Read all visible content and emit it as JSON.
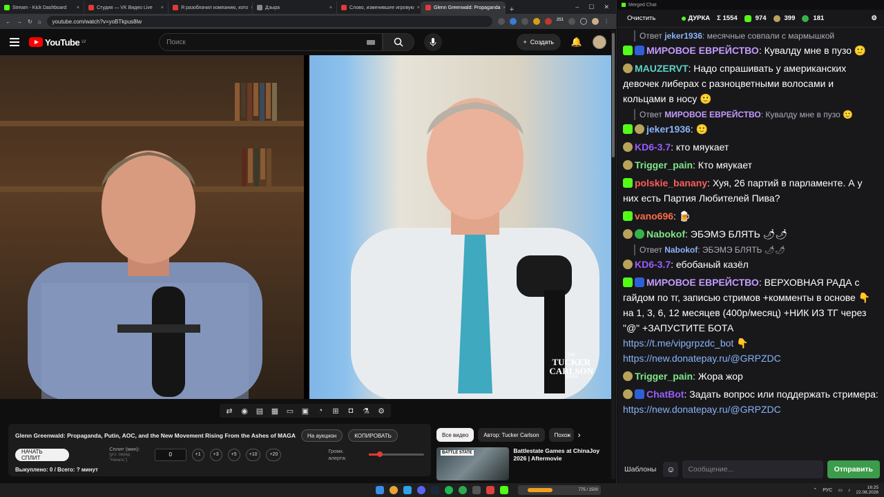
{
  "browser": {
    "tabs": [
      {
        "label": "Stream - Kick Dashboard",
        "color": "#53fc18"
      },
      {
        "label": "Студия — VK Видео Live",
        "color": "#e03a3a"
      },
      {
        "label": "Я разоблачил компанию, кото",
        "color": "#e03a3a"
      },
      {
        "label": "Дзыра",
        "color": "#888888"
      },
      {
        "label": "Слово, изменившее игровую",
        "color": "#e03a3a"
      },
      {
        "label": "Glenn Greenwald: Propaganda",
        "color": "#e03a3a"
      }
    ],
    "url": "youtube.com/watch?v=yoBTkpus8lw",
    "ext_badge": "251"
  },
  "youtube": {
    "logo_text": "YouTube",
    "region": "LV",
    "search_placeholder": "Поиск",
    "create_label": "Создать"
  },
  "video": {
    "watermark_the": "THE",
    "watermark_line1": "TUCKER",
    "watermark_line2": "CARLSON",
    "watermark_show": "SHOW"
  },
  "player_tools": [
    "loop-icon",
    "audio-icon",
    "subtitle-icon",
    "clip-icon",
    "frame-icon",
    "picture-icon",
    "speed-icon",
    "add-icon",
    "screenshot-icon",
    "flask-icon",
    "settings-icon"
  ],
  "info": {
    "title": "Glenn Greenwald: Propaganda, Putin, AOC, and the New Movement Rising From the Ashes of MAGA",
    "auction_label": "На аукцион",
    "copy_label": "КОПИРОВАТЬ",
    "split_button": "НАЧАТЬ СПЛИТ",
    "split_label": "Сплит (мин):",
    "split_hint": "(уст. перед \"Начать\")",
    "split_value": "0",
    "steps": [
      "+1",
      "+3",
      "+5",
      "+10",
      "+20"
    ],
    "volume_label": "Громк. алерта:",
    "volume_level": 0.2,
    "status": "Выкуплено: 0 / Всего: ? минут"
  },
  "related": {
    "chips": [
      "Все видео",
      "Автор: Tucker Carlson",
      "Похож"
    ],
    "item_title": "Battlestate Games at ChinaJoy 2026 | Aftermovie",
    "item_badge": "BATTLE STATE"
  },
  "chat": {
    "window_title": "Merged Chat",
    "clear_label": "Очистить",
    "channel": "ДУРКА",
    "stat_total": "Σ 1554",
    "stat_kick": "974",
    "stat_a": "399",
    "stat_b": "181",
    "messages": [
      {
        "type": "reply",
        "label": "Ответ",
        "user": "jeker1936",
        "user_color": "#8ab4f8",
        "text": ": месячные совпали с мармышкой"
      },
      {
        "type": "msg",
        "badges": [
          "k",
          "b"
        ],
        "user": "МИРОВОЕ ЕВРЕЙСТВО",
        "user_color": "#c49bff",
        "text": ": Кувалду мне в пузо 🙂"
      },
      {
        "type": "msg",
        "badges": [
          "sm"
        ],
        "user": "MAUZERVT",
        "user_color": "#5fd3c6",
        "text": ": Надо спрашивать у американских девочек либерах с разноцветными волосами и кольцами в носу 🙂"
      },
      {
        "type": "reply",
        "label": "Ответ",
        "user": "МИРОВОЕ ЕВРЕЙСТВО",
        "user_color": "#c49bff",
        "text": ": Кувалду мне в пузо 🙂"
      },
      {
        "type": "msg",
        "badges": [
          "k",
          "sm"
        ],
        "user": "jeker1936",
        "user_color": "#8ab4f8",
        "text": ": 🙂"
      },
      {
        "type": "msg",
        "badges": [
          "sm"
        ],
        "user": "KD6-3.7",
        "user_color": "#9b5cff",
        "text": ": кто мяукает"
      },
      {
        "type": "msg",
        "badges": [
          "sm"
        ],
        "user": "Trigger_pain",
        "user_color": "#7ee787",
        "text": ": Кто мяукает"
      },
      {
        "type": "msg",
        "badges": [
          "k"
        ],
        "user": "polskie_banany",
        "user_color": "#ff5c5c",
        "text": ": Хуя, 26 партий в парламенте. А у них есть Партия Любителей Пива?"
      },
      {
        "type": "msg",
        "badges": [
          "k"
        ],
        "user": "vano696",
        "user_color": "#ff6b4a",
        "text": ": 🍺"
      },
      {
        "type": "msg",
        "badges": [
          "sm",
          "g"
        ],
        "user": "Nabokof",
        "user_color": "#7ee787",
        "text": ": ЭБЭМЭ БЛЯТЬ 🌶🌶"
      },
      {
        "type": "reply",
        "label": "Ответ",
        "user": "Nabokof",
        "user_color": "#8ab4f8",
        "text": ": ЭБЭМЭ БЛЯТЬ 🌶🌶"
      },
      {
        "type": "msg",
        "badges": [
          "sm"
        ],
        "user": "KD6-3.7",
        "user_color": "#9b5cff",
        "text": ": ебобаный казёл"
      },
      {
        "type": "msg",
        "badges": [
          "k",
          "b"
        ],
        "user": "МИРОВОЕ ЕВРЕЙСТВО",
        "user_color": "#c49bff",
        "text": ": ВЕРХОВНАЯ РАДА с гайдом по тг, записью стримов +комменты в основе 👇 на 1, 3, 6, 12 месяцев (400р/месяц) +НИК ИЗ ТГ через \"@\" +ЗАПУСТИТЕ БОТА",
        "links": [
          "https://t.me/vipgrpzdc_bot 👇",
          "https://new.donatepay.ru/@GRPZDC"
        ]
      },
      {
        "type": "msg",
        "badges": [
          "sm"
        ],
        "user": "Trigger_pain",
        "user_color": "#7ee787",
        "text": ": Жора жор"
      },
      {
        "type": "msg",
        "badges": [
          "sm",
          "b"
        ],
        "user": "ChatBot",
        "user_color": "#9b5cff",
        "text": ": Задать вопрос или поддержать стримера:",
        "links": [
          "https://new.donatepay.ru/@GRPZDC"
        ]
      }
    ],
    "templates_label": "Шаблоны",
    "input_placeholder": "Сообщение...",
    "send_label": "Отправить"
  },
  "taskbar": {
    "widget_text": "775 / 1500",
    "widget_progress": 0.52,
    "lang": "РУС",
    "time": "16:25",
    "date": "22.08.2026"
  }
}
